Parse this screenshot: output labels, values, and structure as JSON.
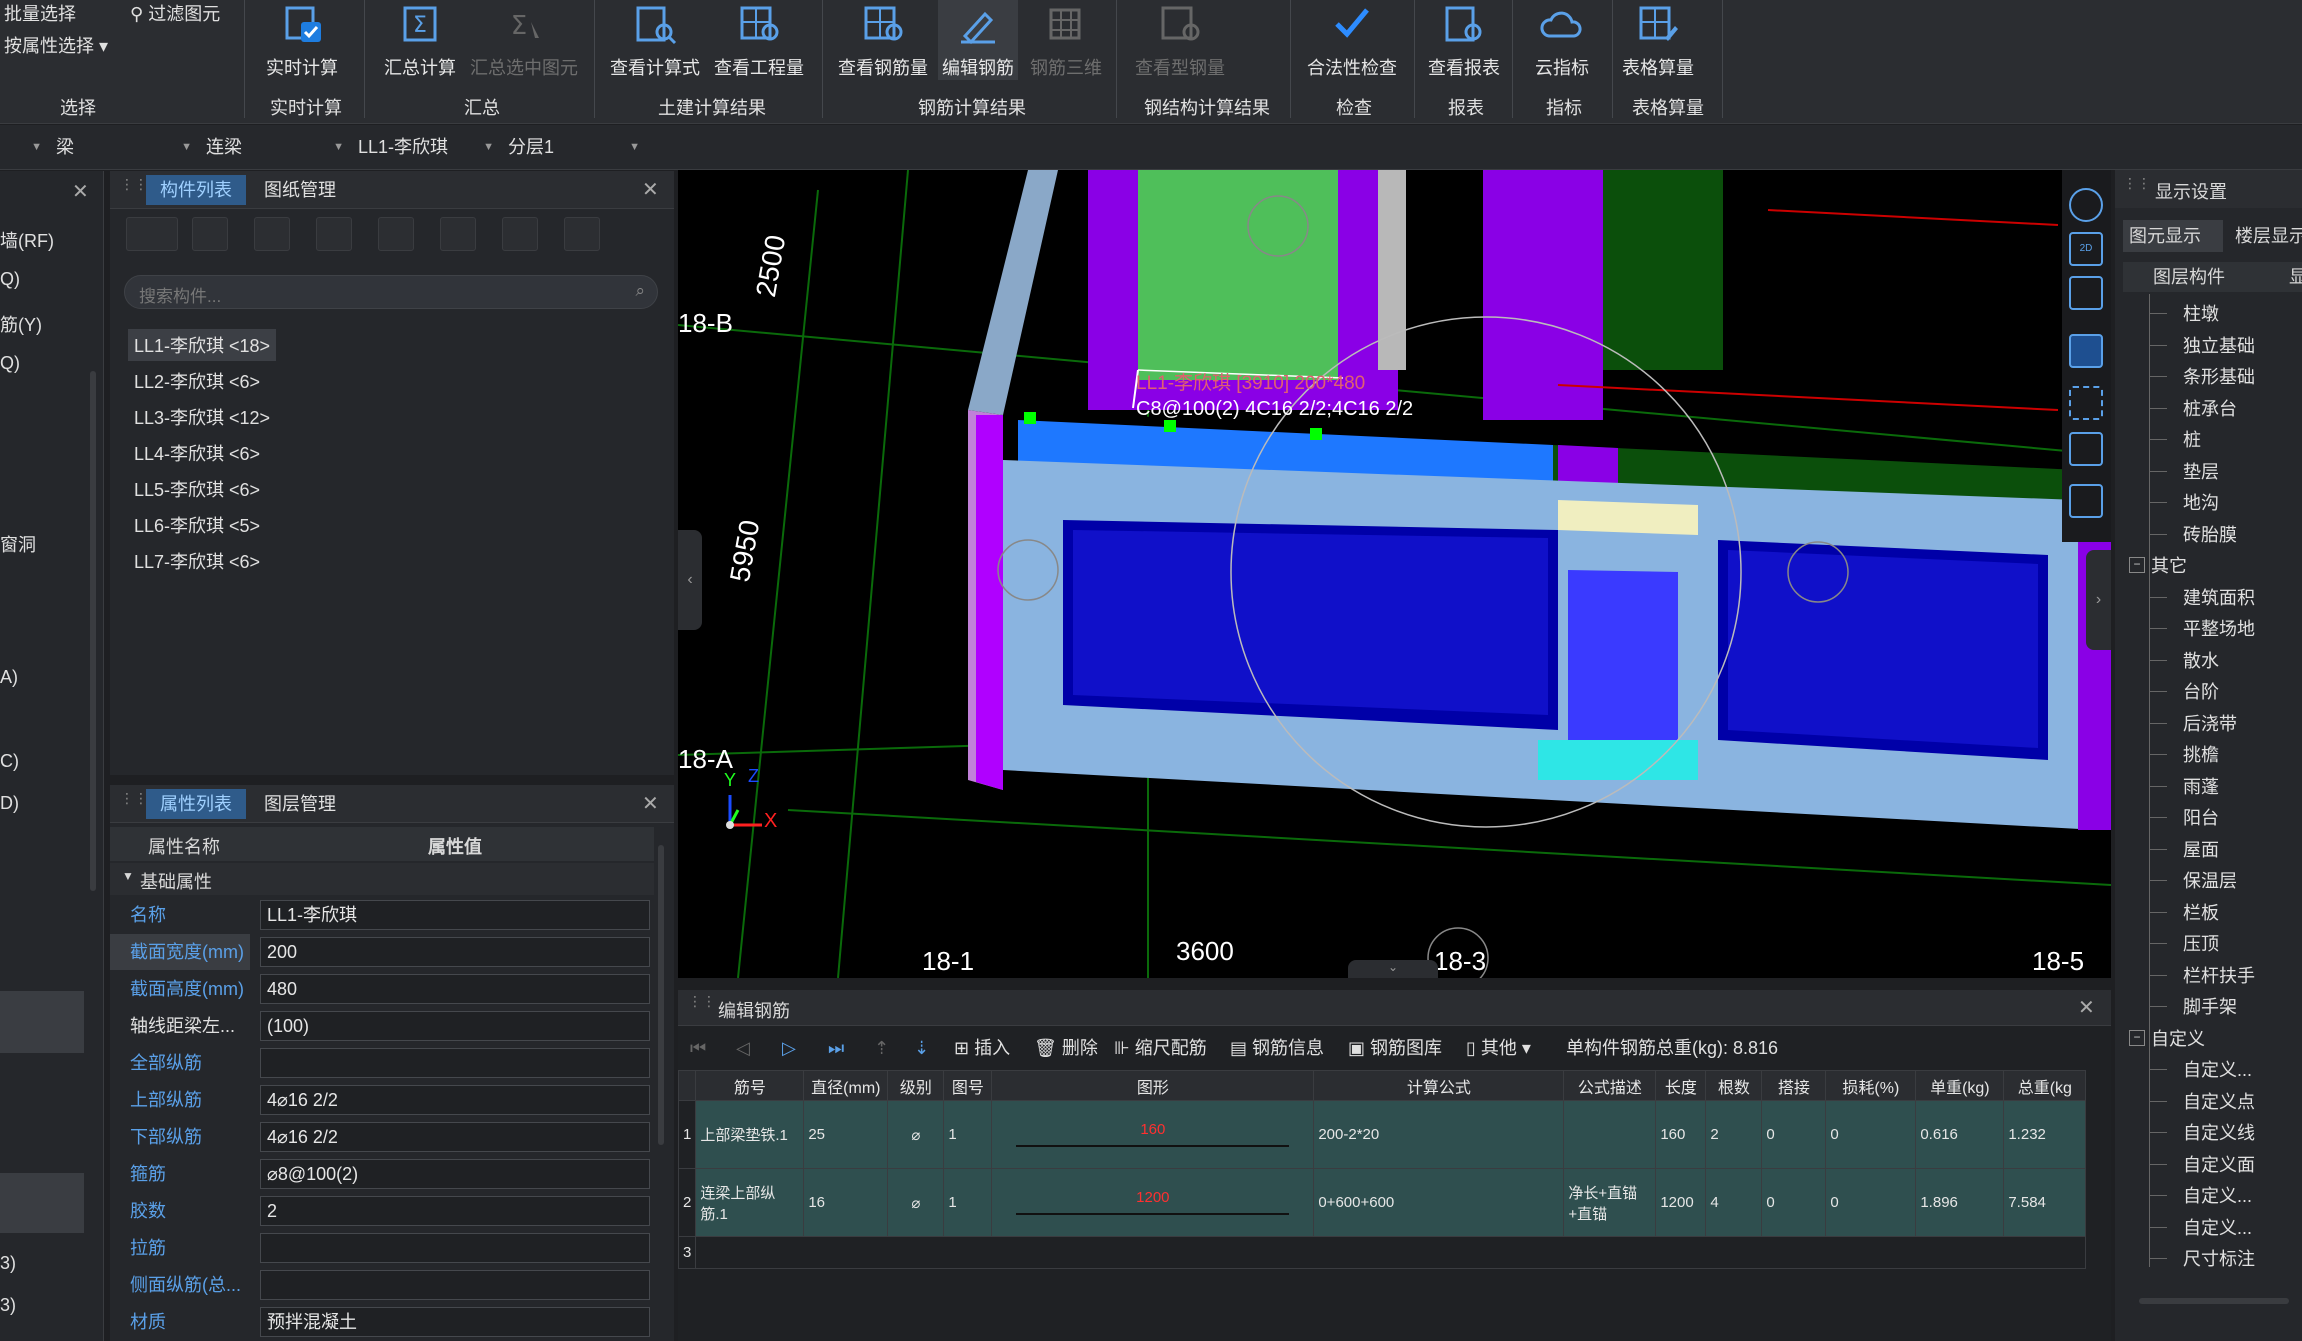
{
  "ribbon": {
    "left_items": [
      "批量选择",
      "按属性选择",
      "过滤图元"
    ],
    "buttons": [
      {
        "label": "实时计算",
        "disabled": false
      },
      {
        "label": "汇总计算",
        "disabled": false
      },
      {
        "label": "汇总选中图元",
        "disabled": true
      },
      {
        "label": "查看计算式",
        "disabled": false
      },
      {
        "label": "查看工程量",
        "disabled": false
      },
      {
        "label": "查看钢筋量",
        "disabled": false
      },
      {
        "label": "编辑钢筋",
        "disabled": false,
        "active": true
      },
      {
        "label": "钢筋三维",
        "disabled": true
      },
      {
        "label": "查看型钢量",
        "disabled": true
      },
      {
        "label": "合法性检查",
        "disabled": false
      },
      {
        "label": "查看报表",
        "disabled": false
      },
      {
        "label": "云指标",
        "disabled": false
      },
      {
        "label": "表格算量",
        "disabled": false
      }
    ],
    "groups": [
      "选择",
      "实时计算",
      "汇总",
      "土建计算结果",
      "钢筋计算结果",
      "钢结构计算结果",
      "检查",
      "报表",
      "指标",
      "表格算量"
    ]
  },
  "combos": [
    "梁",
    "连梁",
    "LL1-李欣琪",
    "分层1"
  ],
  "left_strip": [
    "墙(RF)",
    "Q)",
    "筋(Y)",
    "Q)",
    "窗洞",
    "A)",
    "C)",
    "D)",
    "3)",
    "3)"
  ],
  "component_panel": {
    "tabs": [
      "构件列表",
      "图纸管理"
    ],
    "search_placeholder": "搜索构件...",
    "items": [
      "LL1-李欣琪 <18>",
      "LL2-李欣琪 <6>",
      "LL3-李欣琪 <12>",
      "LL4-李欣琪 <6>",
      "LL5-李欣琪 <6>",
      "LL6-李欣琪 <5>",
      "LL7-李欣琪 <6>"
    ]
  },
  "property_panel": {
    "tabs": [
      "属性列表",
      "图层管理"
    ],
    "col_name": "属性名称",
    "col_value": "属性值",
    "section": "基础属性",
    "rows": [
      {
        "name": "名称",
        "value": "LL1-李欣琪",
        "blue": true
      },
      {
        "name": "截面宽度(mm)",
        "value": "200",
        "blue": true
      },
      {
        "name": "截面高度(mm)",
        "value": "480",
        "blue": true
      },
      {
        "name": "轴线距梁左...",
        "value": "(100)",
        "blue": false
      },
      {
        "name": "全部纵筋",
        "value": "",
        "blue": true
      },
      {
        "name": "上部纵筋",
        "value": "4⌀16 2/2",
        "blue": true
      },
      {
        "name": "下部纵筋",
        "value": "4⌀16 2/2",
        "blue": true
      },
      {
        "name": "箍筋",
        "value": "⌀8@100(2)",
        "blue": true
      },
      {
        "name": "胶数",
        "value": "2",
        "blue": true
      },
      {
        "name": "拉筋",
        "value": "",
        "blue": true
      },
      {
        "name": "侧面纵筋(总...",
        "value": "",
        "blue": true
      },
      {
        "name": "材质",
        "value": "预拌混凝土",
        "blue": true
      }
    ]
  },
  "viewport": {
    "dims": [
      "2500",
      "5950",
      "3600"
    ],
    "axes_rows": [
      "18-B",
      "18-A"
    ],
    "axes_cols": [
      "18-1",
      "18-3",
      "18-5"
    ],
    "beam_label_1": "LL1-李欣琪 [3910] 200*480",
    "beam_label_2": "C8@100(2) 4C16 2/2;4C16 2/2",
    "axis_x": "X",
    "axis_y": "Y",
    "axis_z": "Z"
  },
  "rebar_panel": {
    "title": "编辑钢筋",
    "tools": [
      "插入",
      "删除",
      "缩尺配筋",
      "钢筋信息",
      "钢筋图库",
      "其他"
    ],
    "total_label": "单构件钢筋总重(kg): 8.816",
    "headers": [
      "筋号",
      "直径(mm)",
      "级别",
      "图号",
      "图形",
      "计算公式",
      "公式描述",
      "长度",
      "根数",
      "搭接",
      "损耗(%)",
      "单重(kg)",
      "总重(kg"
    ],
    "rows": [
      {
        "idx": "1",
        "name": "上部梁垫铁.1",
        "dia": "25",
        "grade": "⌀",
        "fig": "1",
        "shape_len": "160",
        "formula": "200-2*20",
        "desc": "",
        "len": "160",
        "count": "2",
        "lap": "0",
        "loss": "0",
        "unit": "0.616",
        "total": "1.232"
      },
      {
        "idx": "2",
        "name": "连梁上部纵筋.1",
        "dia": "16",
        "grade": "⌀",
        "fig": "1",
        "shape_len": "1200",
        "formula": "0+600+600",
        "desc": "净长+直锚+直锚",
        "len": "1200",
        "count": "4",
        "lap": "0",
        "loss": "0",
        "unit": "1.896",
        "total": "7.584"
      }
    ],
    "empty_idx": "3"
  },
  "display_panel": {
    "title": "显示设置",
    "tabs": [
      "图元显示",
      "楼层显示"
    ],
    "col": "图层构件",
    "col2": "显",
    "group1": [
      "柱墩",
      "独立基础",
      "条形基础",
      "桩承台",
      "桩",
      "垫层",
      "地沟",
      "砖胎膜"
    ],
    "cat2": "其它",
    "group2": [
      "建筑面积",
      "平整场地",
      "散水",
      "台阶",
      "后浇带",
      "挑檐",
      "雨蓬",
      "阳台",
      "屋面",
      "保温层",
      "栏板",
      "压顶",
      "栏杆扶手",
      "脚手架"
    ],
    "cat3": "自定义",
    "group3": [
      "自定义...",
      "自定义点",
      "自定义线",
      "自定义面",
      "自定义...",
      "自定义...",
      "尺寸标注"
    ]
  }
}
